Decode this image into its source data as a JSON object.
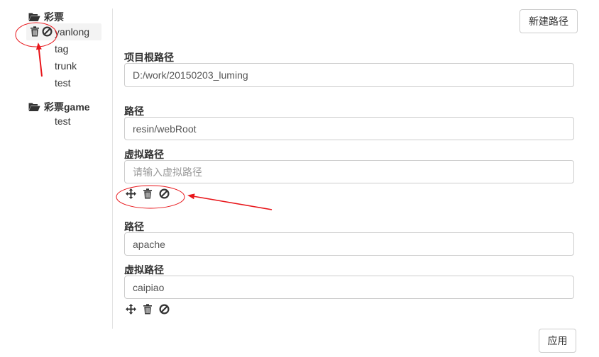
{
  "sidebar": {
    "groups": [
      {
        "label": "彩票",
        "items": [
          "yanlong",
          "tag",
          "trunk",
          "test"
        ],
        "selected": "yanlong"
      },
      {
        "label": "彩票game",
        "items": [
          "test"
        ]
      }
    ]
  },
  "toolbar": {
    "new_path_label": "新建路径"
  },
  "form": {
    "root_path_label": "项目根路径",
    "root_path_value": "D:/work/20150203_luming",
    "entries": [
      {
        "path_label": "路径",
        "path_value": "resin/webRoot",
        "virtual_label": "虚拟路径",
        "virtual_value": "",
        "virtual_placeholder": "请输入虚拟路径"
      },
      {
        "path_label": "路径",
        "path_value": "apache",
        "virtual_label": "虚拟路径",
        "virtual_value": "caipiao"
      }
    ]
  },
  "footer": {
    "apply_label": "应用"
  },
  "icons": {
    "folder": "folder-open-icon",
    "trash": "trash-icon",
    "ban": "ban-icon",
    "move": "move-icon"
  },
  "colors": {
    "annotation": "#e8161b",
    "border": "#cccccc",
    "selected_bg": "#f3f3f3"
  }
}
